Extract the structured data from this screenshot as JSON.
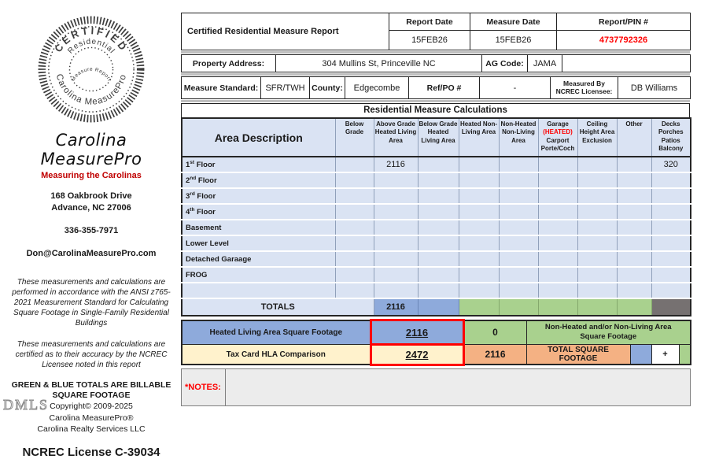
{
  "colors": {
    "pale_blue": "#dae3f3",
    "blue": "#8eaadb",
    "green": "#a9d18e",
    "salmon": "#f4b183",
    "cream": "#fff2cc",
    "dark_gray_cell": "#767171",
    "red": "#ff0000",
    "brand_red": "#c00000"
  },
  "sidebar": {
    "stamp": {
      "arc_top": "CERTIFIED",
      "arc_inner": "Residential",
      "arc_bottom": "Carolina MeasurePro",
      "center": "Measure Report"
    },
    "brand": "Carolina MeasurePro",
    "tagline": "Measuring the Carolinas",
    "address_line1": "168 Oakbrook Drive",
    "address_line2": "Advance, NC  27006",
    "phone": "336-355-7971",
    "email": "Don@CarolinaMeasurePro.com",
    "disclaimer1": "These measurements and calculations are performed in accordance with the ANSI z765-2021 Measurement Standard for Calculating Square Footage in Single-Family Residential Buildings",
    "disclaimer2": "These measurements and calculations are certified as to their accuracy by the NCREC Licensee noted in this report",
    "billable_line1": "GREEN & BLUE TOTALS ARE BILLABLE",
    "billable_line2": "SQUARE FOOTAGE",
    "copyright": "Copyright© 2009-2025",
    "company1": "Carolina MeasurePro®",
    "company2": "Carolina Realty Services LLC",
    "license": "NCREC License C-39034",
    "watermark": "DMLS"
  },
  "header": {
    "title": "Certified Residential Measure Report",
    "report_date_label": "Report Date",
    "report_date": "15FEB26",
    "measure_date_label": "Measure Date",
    "measure_date": "15FEB26",
    "pin_label": "Report/PIN #",
    "pin": "4737792326",
    "property_address_label": "Property Address:",
    "property_address": "304 Mullins St, Princeville NC",
    "ag_code_label": "AG Code:",
    "ag_code": "JAMA",
    "measure_standard_label": "Measure Standard:",
    "measure_standard": "SFR/TWH",
    "county_label": "County:",
    "county": "Edgecombe",
    "ref_po_label": "Ref/PO #",
    "ref_po": "-",
    "measured_by_label_1": "Measured By",
    "measured_by_label_2": "NCREC Licensee:",
    "measured_by": "DB Williams"
  },
  "calc": {
    "section_title": "Residential Measure Calculations",
    "area_header": "Area Description",
    "col_below_grade": "Below Grade",
    "col_above_grade_hla": "Above Grade Heated Living Area",
    "col_below_grade_hla": "Below Grade Heated Living Area",
    "col_heated_nla": "Heated Non-Living Area",
    "col_nonheated_nla": "Non-Heated Non-Living Area",
    "garage_header": {
      "l1": "Garage",
      "l2": "(HEATED)",
      "l3": "Carport",
      "l4": "Porte/Coch"
    },
    "col_ceiling": "Ceiling Height Area Exclusion",
    "col_other": "Other",
    "col_decks": "Decks Porches Patios Balcony",
    "rows": [
      {
        "num": "1",
        "ord": "st",
        "rest": " Floor",
        "values": [
          "",
          "2116",
          "",
          "",
          "",
          "",
          "",
          "",
          "320"
        ]
      },
      {
        "num": "2",
        "ord": "nd",
        "rest": " Floor",
        "values": [
          "",
          "",
          "",
          "",
          "",
          "",
          "",
          "",
          ""
        ]
      },
      {
        "num": "3",
        "ord": "rd",
        "rest": " Floor",
        "values": [
          "",
          "",
          "",
          "",
          "",
          "",
          "",
          "",
          ""
        ]
      },
      {
        "num": "4",
        "ord": "th",
        "rest": " Floor",
        "values": [
          "",
          "",
          "",
          "",
          "",
          "",
          "",
          "",
          ""
        ]
      },
      {
        "num": "Basement",
        "ord": "",
        "rest": "",
        "values": [
          "",
          "",
          "",
          "",
          "",
          "",
          "",
          "",
          ""
        ]
      },
      {
        "num": "Lower Level",
        "ord": "",
        "rest": "",
        "values": [
          "",
          "",
          "",
          "",
          "",
          "",
          "",
          "",
          ""
        ]
      },
      {
        "num": "Detached Garaage",
        "ord": "",
        "rest": "",
        "values": [
          "",
          "",
          "",
          "",
          "",
          "",
          "",
          "",
          ""
        ]
      },
      {
        "num": "FROG",
        "ord": "",
        "rest": "",
        "values": [
          "",
          "",
          "",
          "",
          "",
          "",
          "",
          "",
          ""
        ]
      },
      {
        "num": "",
        "ord": "",
        "rest": "",
        "values": [
          "",
          "",
          "",
          "",
          "",
          "",
          "",
          "",
          ""
        ]
      }
    ],
    "totals_label": "TOTALS",
    "totals_above_grade_hla": "2116"
  },
  "summary": {
    "hla_label": "Heated Living Area Square Footage",
    "hla_value": "2116",
    "non_heated_value": "0",
    "non_heated_label": "Non-Heated and/or Non-Living Area Square Footage",
    "tax_label": "Tax Card HLA Comparison",
    "tax_value": "2472",
    "total_value": "2116",
    "total_label": "TOTAL SQUARE FOOTAGE",
    "plus": "+"
  },
  "notes": {
    "label": "*NOTES:"
  }
}
